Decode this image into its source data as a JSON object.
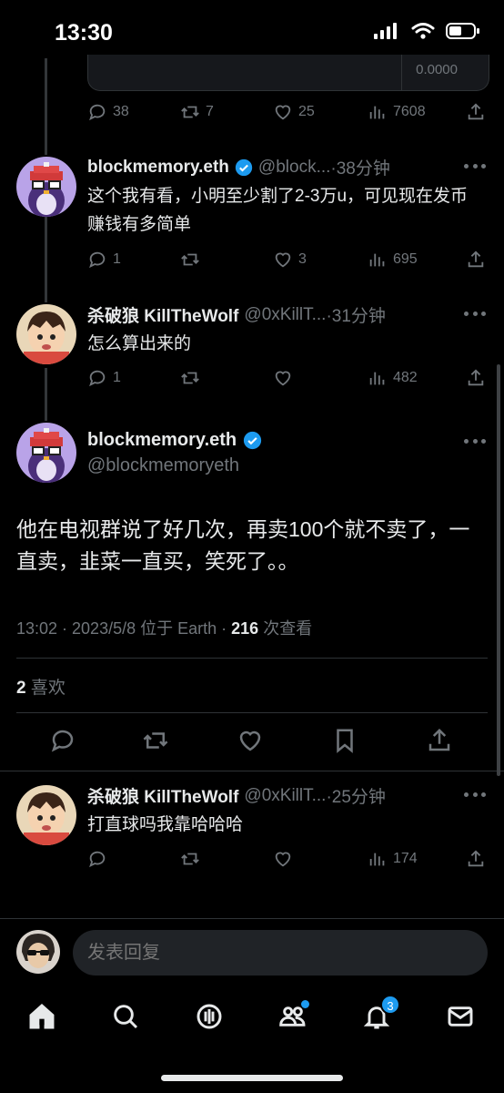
{
  "status": {
    "time": "13:30"
  },
  "top_card": {
    "value": "0.0000"
  },
  "top_actions": {
    "replies": "38",
    "retweets": "7",
    "likes": "25",
    "views": "7608"
  },
  "tweets": [
    {
      "name": "blockmemory.eth",
      "handle": "@block...",
      "time": "·38分钟",
      "text": "这个我有看，小明至少割了2-3万u，可见现在发币赚钱有多简单",
      "replies": "1",
      "retweets": "",
      "likes": "3",
      "views": "695"
    },
    {
      "name": "杀破狼 KillTheWolf",
      "handle": "@0xKillT...",
      "time": "·31分钟",
      "text": "怎么算出来的",
      "replies": "1",
      "retweets": "",
      "likes": "",
      "views": "482"
    }
  ],
  "main_tweet": {
    "name": "blockmemory.eth",
    "handle": "@blockmemoryeth",
    "text": "他在电视群说了好几次，再卖100个就不卖了，一直卖，韭菜一直买，笑死了。。",
    "meta_prefix": "13:02 · 2023/5/8 位于 Earth · ",
    "views_count": "216",
    "views_label": " 次查看",
    "likes_count": "2",
    "likes_label": " 喜欢"
  },
  "bottom_reply": {
    "name": "杀破狼 KillTheWolf",
    "handle": "@0xKillT...",
    "time": "·25分钟",
    "text": "打直球吗我靠哈哈哈",
    "replies": "",
    "retweets": "",
    "likes": "",
    "views": "174"
  },
  "composer": {
    "placeholder": "发表回复"
  },
  "tabbar": {
    "notifications_badge": "3"
  },
  "colors": {
    "accent": "#1d9bf0",
    "background": "#000000",
    "muted": "#71767b"
  }
}
